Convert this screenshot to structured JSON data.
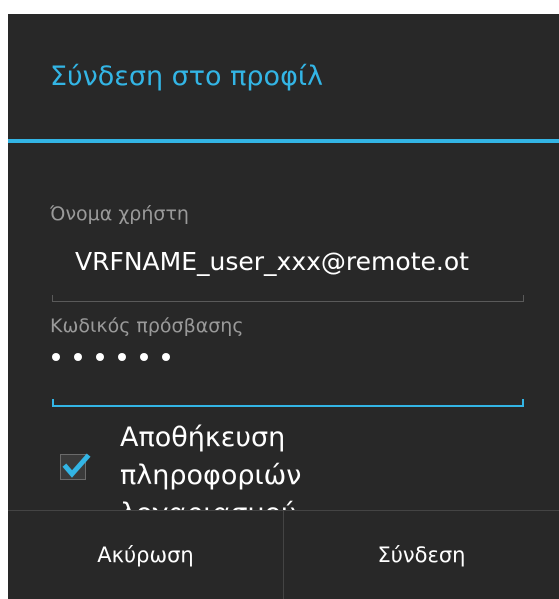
{
  "dialog": {
    "title": "Σύνδεση στο προφίλ",
    "accent_color": "#33b5e5",
    "background_color": "#282828"
  },
  "username": {
    "label": "Όνομα χρήστη",
    "value": "VRFNAME_user_xxx@remote.ot"
  },
  "password": {
    "label": "Κωδικός πρόσβασης",
    "masked_length": 6,
    "focused": true
  },
  "save_credentials": {
    "checked": true,
    "label": "Αποθήκευση πληροφοριών λογαριασμού"
  },
  "buttons": {
    "cancel_label": "Ακύρωση",
    "login_label": "Σύνδεση"
  }
}
